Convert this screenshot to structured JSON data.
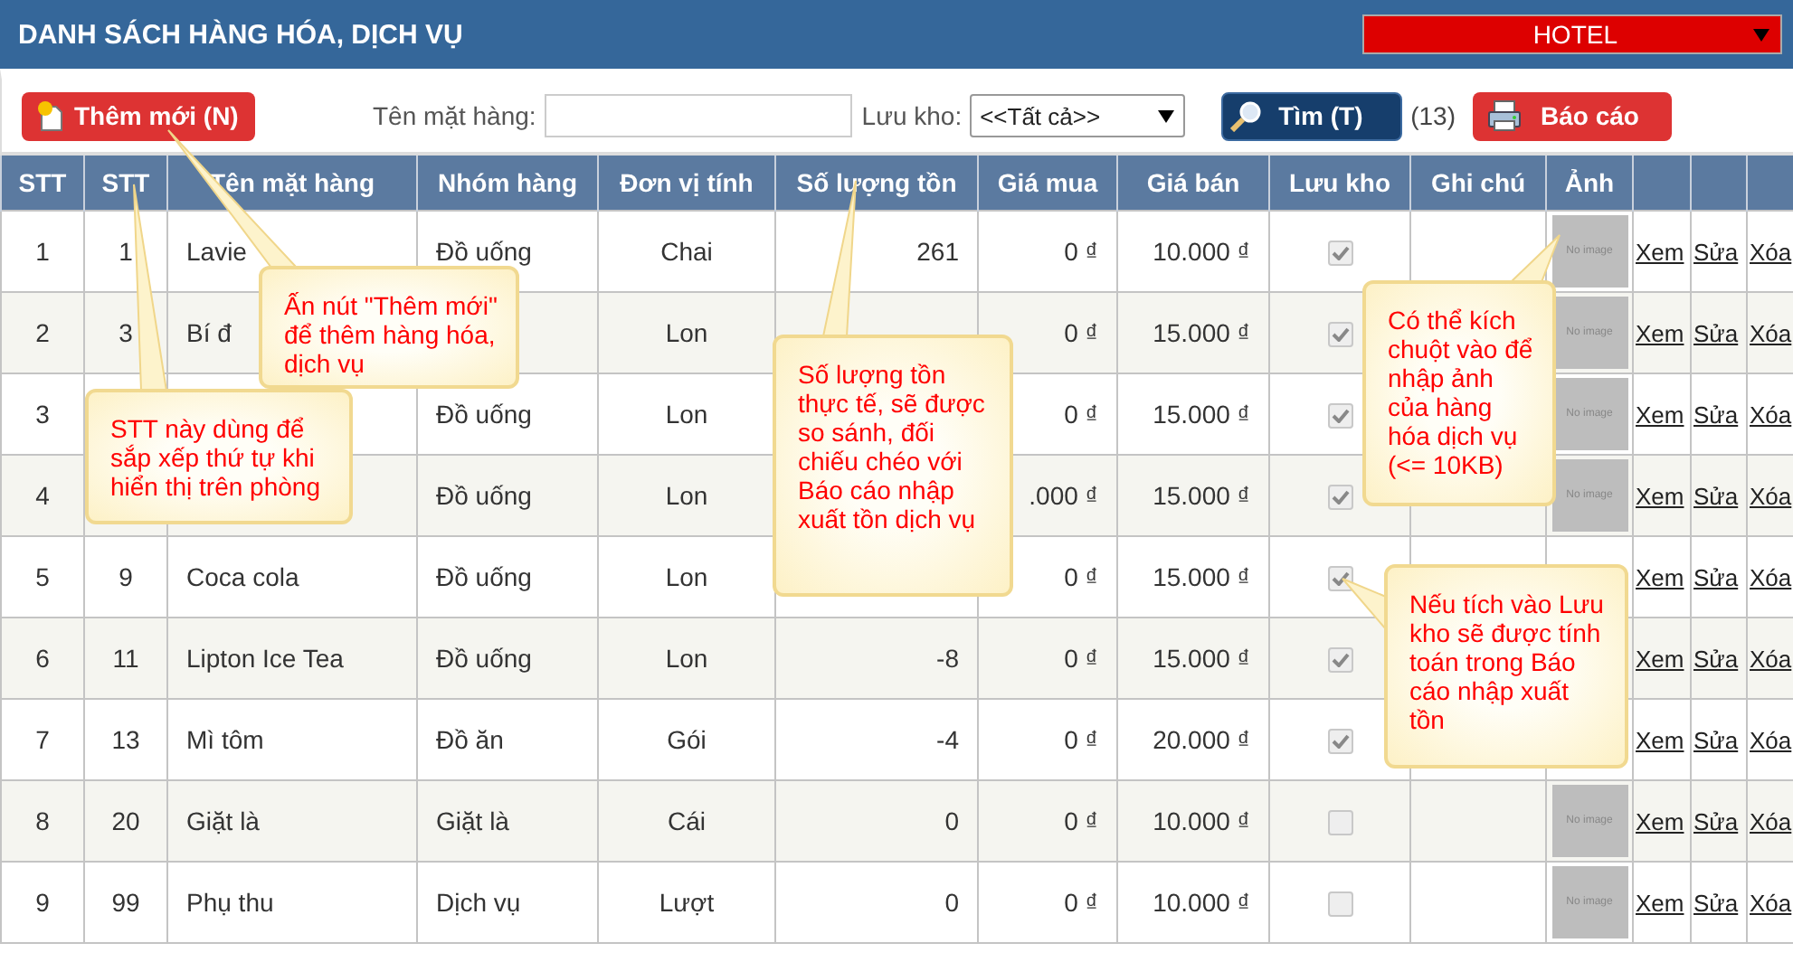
{
  "header": {
    "title": "DANH SÁCH HÀNG HÓA, DỊCH VỤ",
    "hotel_select": "HOTEL"
  },
  "toolbar": {
    "add_button": "Thêm mới (N)",
    "name_label": "Tên mặt hàng:",
    "stock_label": "Lưu kho:",
    "stock_select": "<<Tất cả>>",
    "search_button": "Tìm (T)",
    "count": "(13)",
    "report_button": "Báo cáo"
  },
  "table": {
    "columns": [
      "STT",
      "STT",
      "Tên mặt hàng",
      "Nhóm hàng",
      "Đơn vị tính",
      "Số lượng tồn",
      "Giá mua",
      "Giá bán",
      "Lưu kho",
      "Ghi chú",
      "Ảnh"
    ],
    "rows": [
      {
        "stt": "1",
        "code": "1",
        "name": "Lavie",
        "group": "Đồ uống",
        "unit": "Chai",
        "stock": "261",
        "buy": "0 ₫",
        "sell": "10.000 ₫",
        "checked": true,
        "image": "No image",
        "actions": [
          "Xem",
          "Sửa",
          "Xóa"
        ]
      },
      {
        "stt": "2",
        "code": "3",
        "name": "Bí đ",
        "unit": "Lon",
        "buy": "0 ₫",
        "sell": "15.000 ₫",
        "checked": true,
        "image": "No image",
        "actions": [
          "Xem",
          "Sửa",
          "Xóa"
        ]
      },
      {
        "stt": "3",
        "group": "Đồ uống",
        "unit": "Lon",
        "buy": "0 ₫",
        "sell": "15.000 ₫",
        "checked": true,
        "image": "No image",
        "actions": [
          "Xem",
          "Sửa",
          "Xóa"
        ]
      },
      {
        "stt": "4",
        "group": "Đồ uống",
        "unit": "Lon",
        "buy": ".000 ₫",
        "sell": "15.000 ₫",
        "checked": true,
        "image": "No image",
        "actions": [
          "Xem",
          "Sửa",
          "Xóa"
        ]
      },
      {
        "stt": "5",
        "code": "9",
        "name": "Coca cola",
        "group": "Đồ uống",
        "unit": "Lon",
        "buy": "0 ₫",
        "sell": "15.000 ₫",
        "checked": true,
        "actions": [
          "Xem",
          "Sửa",
          "Xóa"
        ]
      },
      {
        "stt": "6",
        "code": "11",
        "name": "Lipton Ice Tea",
        "group": "Đồ uống",
        "unit": "Lon",
        "stock": "-8",
        "buy": "0 ₫",
        "sell": "15.000 ₫",
        "checked": true,
        "actions": [
          "Xem",
          "Sửa",
          "Xóa"
        ]
      },
      {
        "stt": "7",
        "code": "13",
        "name": "Mì tôm",
        "group": "Đồ ăn",
        "unit": "Gói",
        "stock": "-4",
        "buy": "0 ₫",
        "sell": "20.000 ₫",
        "checked": true,
        "actions": [
          "Xem",
          "Sửa",
          "Xóa"
        ]
      },
      {
        "stt": "8",
        "code": "20",
        "name": "Giặt là",
        "group": "Giặt là",
        "unit": "Cái",
        "stock": "0",
        "buy": "0 ₫",
        "sell": "10.000 ₫",
        "checked": false,
        "image": "No image",
        "actions": [
          "Xem",
          "Sửa",
          "Xóa"
        ]
      },
      {
        "stt": "9",
        "code": "99",
        "name": "Phụ thu",
        "group": "Dịch vụ",
        "unit": "Lượt",
        "stock": "0",
        "buy": "0 ₫",
        "sell": "10.000 ₫",
        "checked": false,
        "image": "No image",
        "actions": [
          "Xem",
          "Sửa",
          "Xóa"
        ]
      }
    ]
  },
  "callouts": [
    {
      "text": "Ấn nút \"Thêm mới\" để thêm hàng hóa, dịch vụ"
    },
    {
      "text": "STT này dùng để sắp xếp thứ tự khi hiển thị trên phòng"
    },
    {
      "text": "Số lượng tồn thực tế, sẽ được so sánh, đối chiếu chéo với Báo cáo nhập xuất tồn dịch vụ"
    },
    {
      "text": "Có thể kích chuột vào để nhập ảnh của hàng hóa dịch vụ (<= 10KB)"
    },
    {
      "text": "Nếu tích vào Lưu kho sẽ được tính toán trong Báo cáo nhập xuất tồn"
    }
  ]
}
